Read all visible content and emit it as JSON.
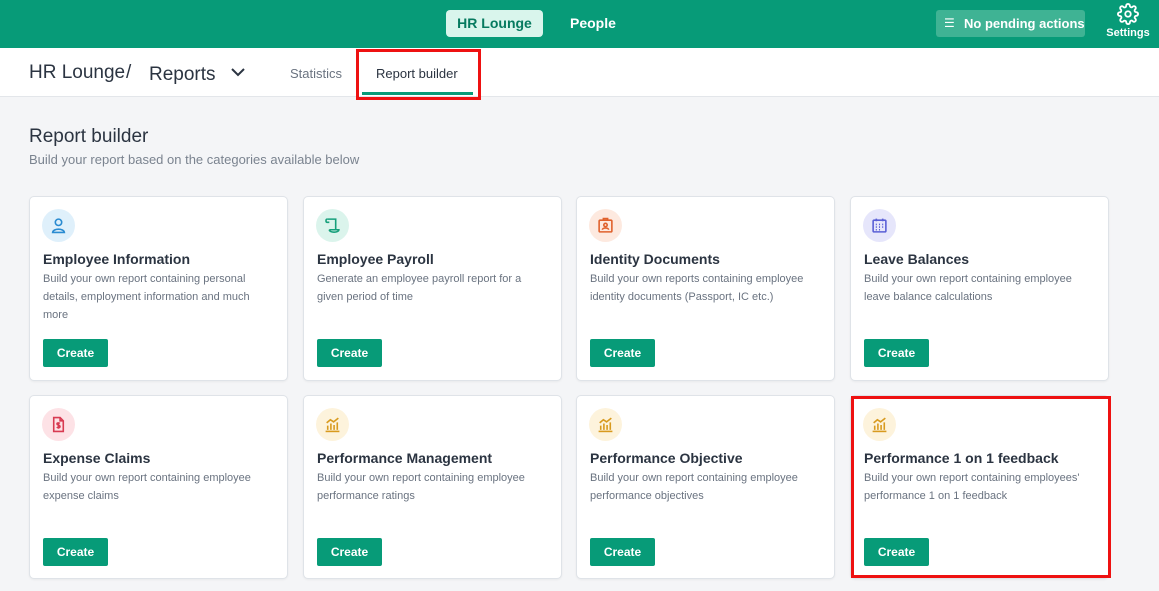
{
  "topbar": {
    "nav_active": "HR Lounge",
    "nav_people": "People",
    "pending_label": "No pending actions",
    "settings_label": "Settings"
  },
  "breadcrumb": {
    "home": "HR Lounge",
    "separator": "/",
    "page": "Reports"
  },
  "tabs": {
    "statistics": "Statistics",
    "report_builder": "Report builder"
  },
  "main": {
    "title": "Report builder",
    "subtitle": "Build your report based on the categories available below"
  },
  "cards": [
    {
      "title": "Employee Information",
      "desc": "Build your own report containing personal details, employment information and much more",
      "button": "Create",
      "icon": "user-icon",
      "icon_bg": "#dff0fb",
      "icon_color": "#2a8bd1"
    },
    {
      "title": "Employee Payroll",
      "desc": "Generate an employee payroll report for a given period of time",
      "button": "Create",
      "icon": "scroll-icon",
      "icon_bg": "#dbf4ec",
      "icon_color": "#16a07b"
    },
    {
      "title": "Identity Documents",
      "desc": "Build your own reports containing employee identity documents (Passport, IC etc.)",
      "button": "Create",
      "icon": "id-card-icon",
      "icon_bg": "#fde9df",
      "icon_color": "#e0612c"
    },
    {
      "title": "Leave Balances",
      "desc": "Build your own report containing employee leave balance calculations",
      "button": "Create",
      "icon": "calendar-icon",
      "icon_bg": "#e6e6fb",
      "icon_color": "#5a5fd6"
    },
    {
      "title": "Expense Claims",
      "desc": "Build your own report containing employee expense claims",
      "button": "Create",
      "icon": "receipt-icon",
      "icon_bg": "#fde2e6",
      "icon_color": "#d83b52"
    },
    {
      "title": "Performance Management",
      "desc": "Build your own report containing employee performance ratings",
      "button": "Create",
      "icon": "bar-chart-icon",
      "icon_bg": "#fdf3dc",
      "icon_color": "#d89a1e"
    },
    {
      "title": "Performance Objective",
      "desc": "Build your own report containing employee performance objectives",
      "button": "Create",
      "icon": "bar-chart-icon",
      "icon_bg": "#fdf3dc",
      "icon_color": "#d89a1e"
    },
    {
      "title": "Performance 1 on 1 feedback",
      "desc": "Build your own report containing employees' performance 1 on 1 feedback",
      "button": "Create",
      "icon": "bar-chart-icon",
      "icon_bg": "#fdf3dc",
      "icon_color": "#d89a1e"
    }
  ],
  "colors": {
    "brand": "#079b78",
    "highlight": "#ee1111"
  }
}
